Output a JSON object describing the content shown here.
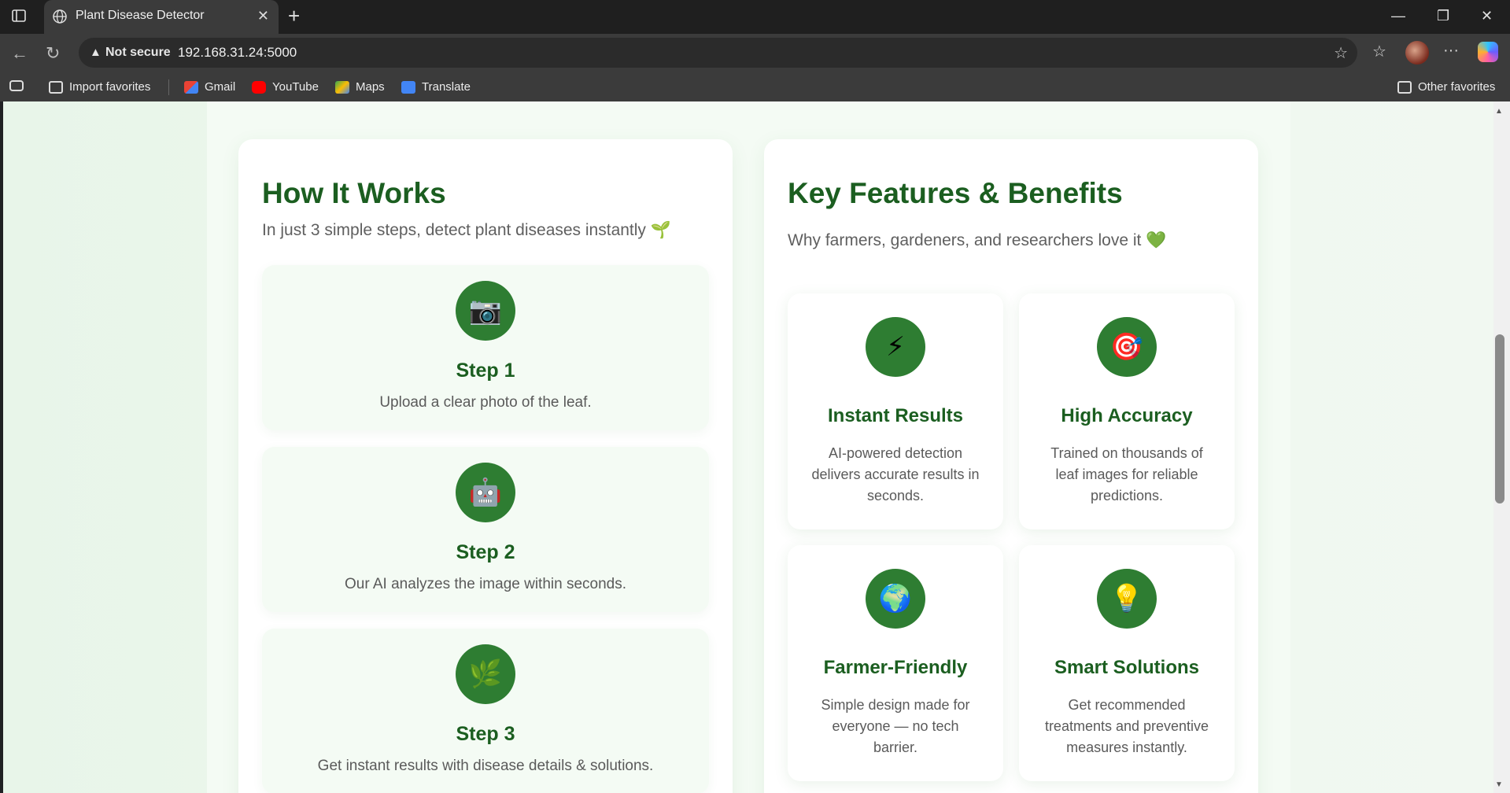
{
  "browser": {
    "tab_title": "Plant Disease Detector",
    "security_label": "Not secure",
    "url": "192.168.31.24:5000",
    "bookmarks": [
      "Import favorites",
      "Gmail",
      "YouTube",
      "Maps",
      "Translate"
    ],
    "other_favorites": "Other favorites"
  },
  "how_it_works": {
    "title": "How It Works",
    "subtitle": "In just 3 simple steps, detect plant diseases instantly 🌱",
    "steps": [
      {
        "icon": "📷",
        "title": "Step 1",
        "desc": "Upload a clear photo of the leaf."
      },
      {
        "icon": "🤖",
        "title": "Step 2",
        "desc": "Our AI analyzes the image within seconds."
      },
      {
        "icon": "🌿",
        "title": "Step 3",
        "desc": "Get instant results with disease details & solutions."
      }
    ]
  },
  "features": {
    "title": "Key Features & Benefits",
    "subtitle": "Why farmers, gardeners, and researchers love it 💚",
    "items": [
      {
        "icon": "⚡",
        "title": "Instant Results",
        "desc": "AI-powered detection delivers accurate results in seconds."
      },
      {
        "icon": "🎯",
        "title": "High Accuracy",
        "desc": "Trained on thousands of leaf images for reliable predictions."
      },
      {
        "icon": "🌍",
        "title": "Farmer-Friendly",
        "desc": "Simple design made for everyone — no tech barrier."
      },
      {
        "icon": "💡",
        "title": "Smart Solutions",
        "desc": "Get recommended treatments and preventive measures instantly."
      }
    ]
  },
  "colors": {
    "accent_green": "#2e7d32",
    "title_green": "#1b5e20"
  }
}
